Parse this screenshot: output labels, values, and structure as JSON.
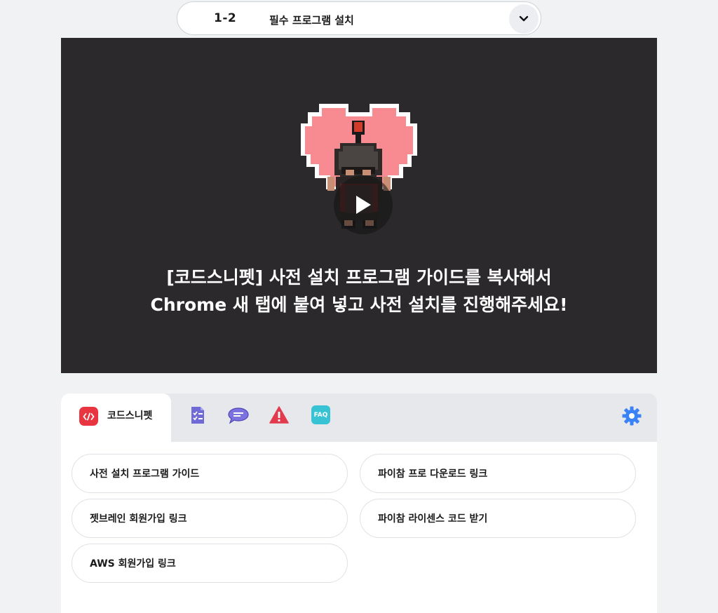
{
  "lesson_selector": {
    "number": "1-2",
    "title": "필수 프로그램 설치"
  },
  "video": {
    "caption_line1": "[코드스니펫] 사전 설치 프로그램 가이드를 복사해서",
    "caption_line2": "Chrome 새 탭에 붙여 넣고 사전 설치를 진행해주세요!"
  },
  "tabs": {
    "active_label": "코드스니펫",
    "icons": [
      "checklist-icon",
      "chat-bubble-icon",
      "warning-icon",
      "faq-icon"
    ],
    "faq_text": "FAQ"
  },
  "links": [
    "사전 설치 프로그램 가이드",
    "파이참 프로 다운로드 링크",
    "젯브레인 회원가입 링크",
    "파이참 라이센스 코드 받기",
    "AWS 회원가입 링크"
  ],
  "colors": {
    "brand_red": "#e8353f",
    "video_bg": "#2b292c",
    "settings_blue": "#3b82f6",
    "checklist_purple": "#6f6ad6",
    "warning_red": "#e23b4e",
    "faq_teal": "#37c3d3"
  }
}
